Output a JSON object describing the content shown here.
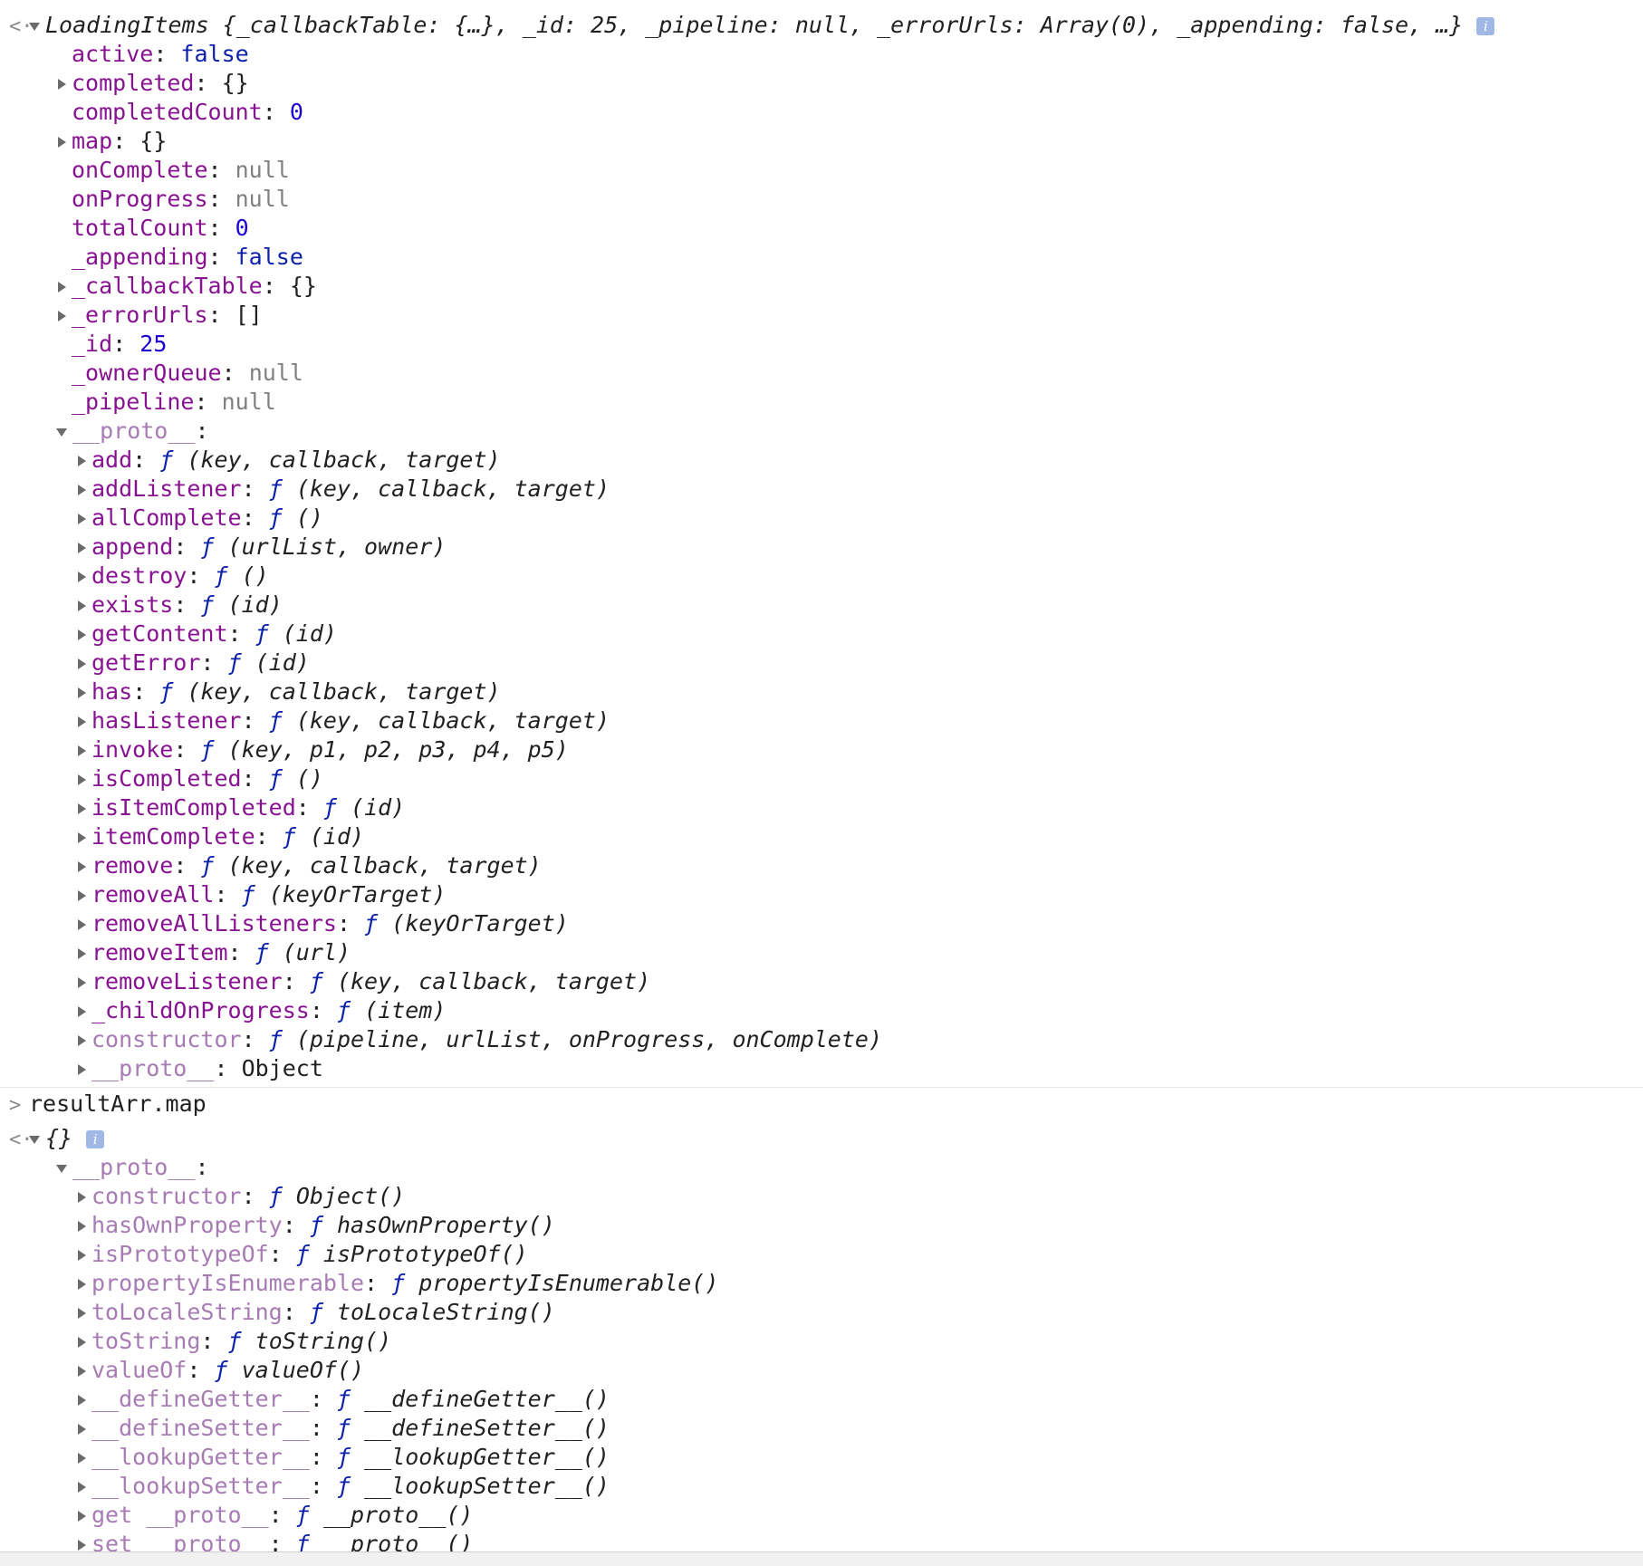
{
  "icons": {
    "expanded": "triangle-down-icon",
    "collapsed": "triangle-right-icon",
    "result": "result-arrow-icon",
    "prompt": "prompt-chevron-icon",
    "info": "info-icon"
  },
  "colors": {
    "key": "#881391",
    "dim_key": "#a77bb3",
    "number": "#1c00cf",
    "boolean": "#0d22aa",
    "null": "#808080"
  },
  "block1": {
    "result_arrow": "<·",
    "summary": "LoadingItems {_callbackTable: {…}, _id: 25, _pipeline: null, _errorUrls: Array(0), _appending: false, …}",
    "info_glyph": "i",
    "props": [
      {
        "key": "active",
        "value": "false",
        "type": "bool",
        "expandable": false
      },
      {
        "key": "completed",
        "value": "{}",
        "type": "obj",
        "expandable": true
      },
      {
        "key": "completedCount",
        "value": "0",
        "type": "num",
        "expandable": false
      },
      {
        "key": "map",
        "value": "{}",
        "type": "obj",
        "expandable": true
      },
      {
        "key": "onComplete",
        "value": "null",
        "type": "nul",
        "expandable": false
      },
      {
        "key": "onProgress",
        "value": "null",
        "type": "nul",
        "expandable": false
      },
      {
        "key": "totalCount",
        "value": "0",
        "type": "num",
        "expandable": false
      },
      {
        "key": "_appending",
        "value": "false",
        "type": "bool",
        "expandable": false
      },
      {
        "key": "_callbackTable",
        "value": "{}",
        "type": "obj",
        "expandable": true
      },
      {
        "key": "_errorUrls",
        "value": "[]",
        "type": "obj",
        "expandable": true
      },
      {
        "key": "_id",
        "value": "25",
        "type": "num",
        "expandable": false
      },
      {
        "key": "_ownerQueue",
        "value": "null",
        "type": "nul",
        "expandable": false
      },
      {
        "key": "_pipeline",
        "value": "null",
        "type": "nul",
        "expandable": false
      }
    ],
    "proto_label": "__proto__",
    "proto_items": [
      {
        "key": "add",
        "sig": "(key, callback, target)",
        "dim": false
      },
      {
        "key": "addListener",
        "sig": "(key, callback, target)",
        "dim": false
      },
      {
        "key": "allComplete",
        "sig": "()",
        "dim": false
      },
      {
        "key": "append",
        "sig": "(urlList, owner)",
        "dim": false
      },
      {
        "key": "destroy",
        "sig": "()",
        "dim": false
      },
      {
        "key": "exists",
        "sig": "(id)",
        "dim": false
      },
      {
        "key": "getContent",
        "sig": "(id)",
        "dim": false
      },
      {
        "key": "getError",
        "sig": "(id)",
        "dim": false
      },
      {
        "key": "has",
        "sig": "(key, callback, target)",
        "dim": false
      },
      {
        "key": "hasListener",
        "sig": "(key, callback, target)",
        "dim": false
      },
      {
        "key": "invoke",
        "sig": "(key, p1, p2, p3, p4, p5)",
        "dim": false
      },
      {
        "key": "isCompleted",
        "sig": "()",
        "dim": false
      },
      {
        "key": "isItemCompleted",
        "sig": "(id)",
        "dim": false
      },
      {
        "key": "itemComplete",
        "sig": "(id)",
        "dim": false
      },
      {
        "key": "remove",
        "sig": "(key, callback, target)",
        "dim": false
      },
      {
        "key": "removeAll",
        "sig": "(keyOrTarget)",
        "dim": false
      },
      {
        "key": "removeAllListeners",
        "sig": "(keyOrTarget)",
        "dim": false
      },
      {
        "key": "removeItem",
        "sig": "(url)",
        "dim": false
      },
      {
        "key": "removeListener",
        "sig": "(key, callback, target)",
        "dim": false
      },
      {
        "key": "_childOnProgress",
        "sig": "(item)",
        "dim": false
      },
      {
        "key": "constructor",
        "sig": "(pipeline, urlList, onProgress, onComplete)",
        "dim": true
      }
    ],
    "proto_tail": {
      "key": "__proto__",
      "value": "Object"
    }
  },
  "input": {
    "prompt": ">",
    "command": "resultArr.map"
  },
  "block2": {
    "result_arrow": "<·",
    "summary": "{}",
    "info_glyph": "i",
    "proto_label": "__proto__",
    "proto_items": [
      {
        "key": "constructor",
        "sig": "Object()"
      },
      {
        "key": "hasOwnProperty",
        "sig": "hasOwnProperty()"
      },
      {
        "key": "isPrototypeOf",
        "sig": "isPrototypeOf()"
      },
      {
        "key": "propertyIsEnumerable",
        "sig": "propertyIsEnumerable()"
      },
      {
        "key": "toLocaleString",
        "sig": "toLocaleString()"
      },
      {
        "key": "toString",
        "sig": "toString()"
      },
      {
        "key": "valueOf",
        "sig": "valueOf()"
      },
      {
        "key": "__defineGetter__",
        "sig": "__defineGetter__()"
      },
      {
        "key": "__defineSetter__",
        "sig": "__defineSetter__()"
      },
      {
        "key": "__lookupGetter__",
        "sig": "__lookupGetter__()"
      },
      {
        "key": "__lookupSetter__",
        "sig": "__lookupSetter__()"
      },
      {
        "key": "get __proto__",
        "sig": "__proto__()"
      },
      {
        "key": "set __proto__",
        "sig": "__proto__()"
      }
    ],
    "f_glyph": "ƒ"
  }
}
